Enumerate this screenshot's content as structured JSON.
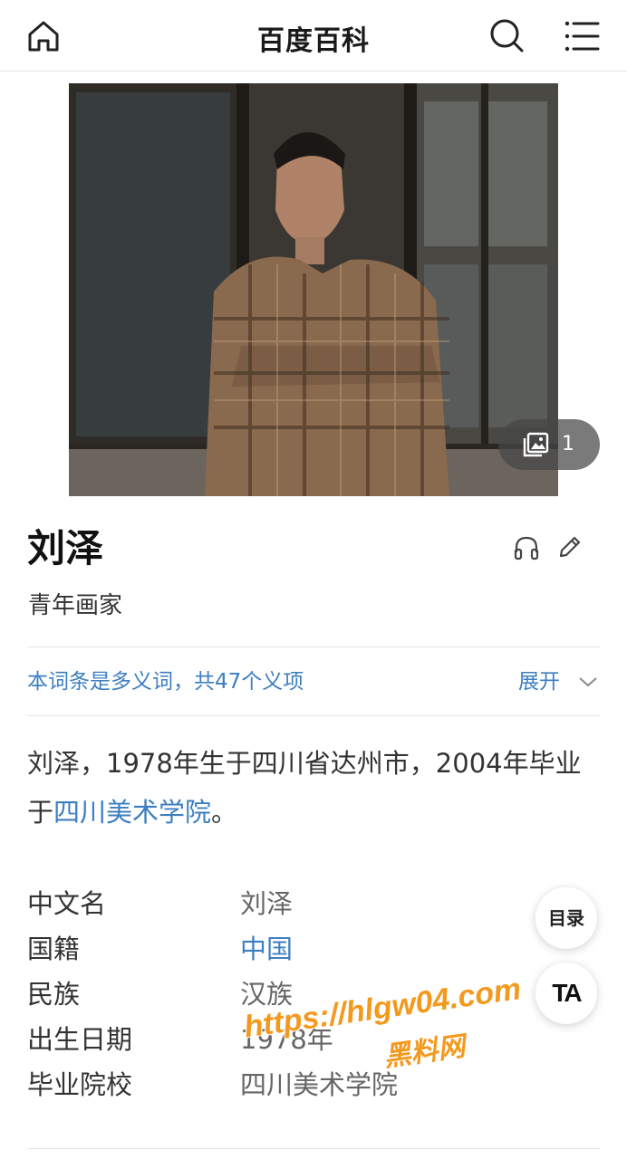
{
  "header": {
    "title": "百度百科",
    "home_icon": "home-icon",
    "search_icon": "search-icon",
    "menu_icon": "menu-icon"
  },
  "hero": {
    "photo_count": "1",
    "gallery_icon": "gallery-icon"
  },
  "entry": {
    "name": "刘泽",
    "subtitle": "青年画家",
    "listen_icon": "headphones-icon",
    "edit_icon": "pencil-icon"
  },
  "polysemy": {
    "text": "本词条是多义词，共47个义项",
    "expand_label": "展开"
  },
  "summary": {
    "text_before": "刘泽，1978年生于四川省达州市，2004年毕业于",
    "link": "四川美术学院",
    "text_after": "。"
  },
  "infobox": [
    {
      "key": "中文名",
      "value": "刘泽",
      "is_link": false
    },
    {
      "key": "国籍",
      "value": "中国",
      "is_link": true
    },
    {
      "key": "民族",
      "value": "汉族",
      "is_link": false
    },
    {
      "key": "出生日期",
      "value": "1978年",
      "is_link": false
    },
    {
      "key": "毕业院校",
      "value": "四川美术学院",
      "is_link": false
    }
  ],
  "floating": {
    "toc_label": "目录",
    "font_label": "TA"
  },
  "watermark": {
    "url": "https://hlgw04.com",
    "site": "黑料网"
  },
  "colors": {
    "link": "#3d7fc1",
    "watermark": "#f39a1e"
  }
}
